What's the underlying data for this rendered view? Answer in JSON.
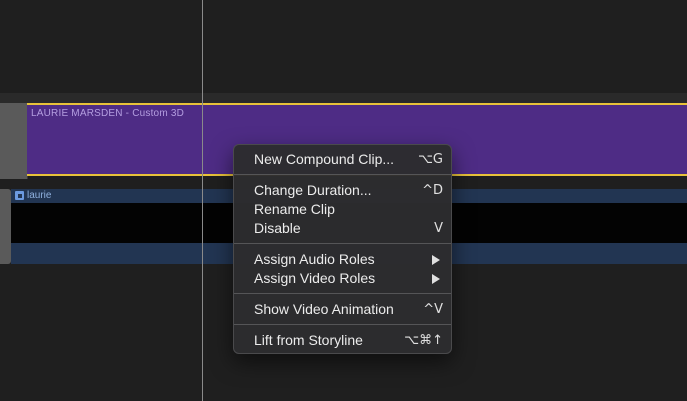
{
  "timeline": {
    "title_clip": {
      "label": "LAURIE MARSDEN - Custom 3D",
      "color": "#4e2c85",
      "selection_color": "#e8c23a"
    },
    "video_clip": {
      "label": "laurie",
      "color": "#223552"
    }
  },
  "context_menu": {
    "items": [
      {
        "label": "New Compound Clip...",
        "shortcut": "⌥G",
        "has_submenu": false
      },
      {
        "label": "Change Duration...",
        "shortcut": "^D",
        "has_submenu": false
      },
      {
        "label": "Rename Clip",
        "shortcut": "",
        "has_submenu": false
      },
      {
        "label": "Disable",
        "shortcut": "V",
        "has_submenu": false
      },
      {
        "label": "Assign Audio Roles",
        "shortcut": "",
        "has_submenu": true
      },
      {
        "label": "Assign Video Roles",
        "shortcut": "",
        "has_submenu": true
      },
      {
        "label": "Show Video Animation",
        "shortcut": "^V",
        "has_submenu": false
      },
      {
        "label": "Lift from Storyline",
        "shortcut": "⌥⌘↑",
        "has_submenu": false
      }
    ]
  }
}
